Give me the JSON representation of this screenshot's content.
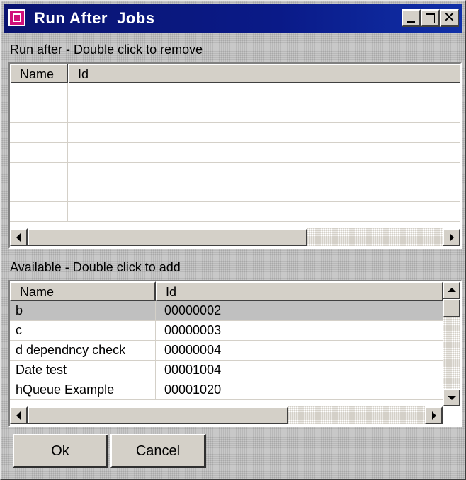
{
  "window": {
    "title": "Run After  Jobs",
    "icon": "app-icon",
    "title_gradient": [
      "#0a1470",
      "#1030a8"
    ]
  },
  "run_after": {
    "label": "Run after - Double click to remove",
    "columns": [
      "Name",
      "Id"
    ],
    "rows": []
  },
  "available": {
    "label": "Available - Double click to add",
    "columns": [
      "Name",
      "Id"
    ],
    "rows": [
      {
        "name": "b",
        "id": "00000002"
      },
      {
        "name": "c",
        "id": "00000003"
      },
      {
        "name": "d dependncy check",
        "id": "00000004"
      },
      {
        "name": "Date test",
        "id": "00001004"
      },
      {
        "name": "hQueue Example",
        "id": "00001020"
      }
    ],
    "selected_row": 0
  },
  "buttons": {
    "ok": "Ok",
    "cancel": "Cancel"
  }
}
